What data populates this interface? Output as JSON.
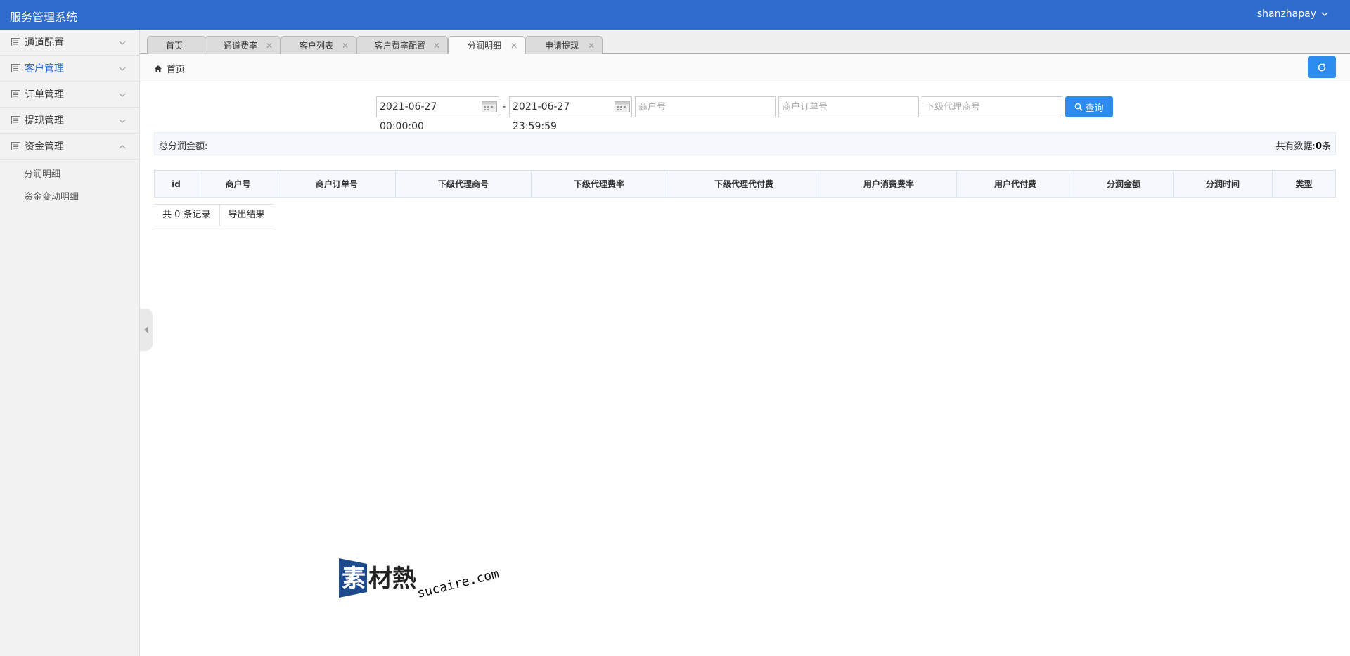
{
  "header": {
    "title": "服务管理系统",
    "user": "shanzhapay"
  },
  "sidebar": {
    "items": [
      {
        "label": "通道配置",
        "active": false,
        "expanded": false
      },
      {
        "label": "客户管理",
        "active": true,
        "expanded": false
      },
      {
        "label": "订单管理",
        "active": false,
        "expanded": false
      },
      {
        "label": "提现管理",
        "active": false,
        "expanded": false
      },
      {
        "label": "资金管理",
        "active": false,
        "expanded": true
      }
    ],
    "submenu": [
      "分润明细",
      "资金变动明细"
    ]
  },
  "tabs": [
    {
      "label": "首页",
      "closable": false,
      "active": false
    },
    {
      "label": "通道费率",
      "closable": true,
      "active": false
    },
    {
      "label": "客户列表",
      "closable": true,
      "active": false
    },
    {
      "label": "客户费率配置",
      "closable": true,
      "active": false
    },
    {
      "label": "分润明细",
      "closable": true,
      "active": true
    },
    {
      "label": "申请提现",
      "closable": true,
      "active": false
    }
  ],
  "breadcrumb": {
    "label": "首页"
  },
  "filters": {
    "start_date": "2021-06-27 00:00:00",
    "separator": "-",
    "end_date": "2021-06-27 23:59:59",
    "merchant_placeholder": "商户号",
    "order_placeholder": "商户订单号",
    "agent_placeholder": "下级代理商号",
    "search_label": "查询"
  },
  "summary": {
    "total_label": "总分润金额:",
    "count_label": "共有数据:",
    "count_value": "0",
    "count_unit": "条"
  },
  "table": {
    "columns": [
      "id",
      "商户号",
      "商户订单号",
      "下级代理商号",
      "下级代理费率",
      "下级代理代付费",
      "用户消费费率",
      "用户代付费",
      "分润金额",
      "分润时间",
      "类型"
    ],
    "rows": []
  },
  "pager": {
    "count_text": "共 0 条记录",
    "export_label": "导出结果"
  },
  "watermark": {
    "cn": "素材熱",
    "en": "sucaire.com"
  },
  "colors": {
    "header": "#2d6ccc",
    "primary_button": "#2d8cf0",
    "active_menu": "#2d6ccc"
  }
}
